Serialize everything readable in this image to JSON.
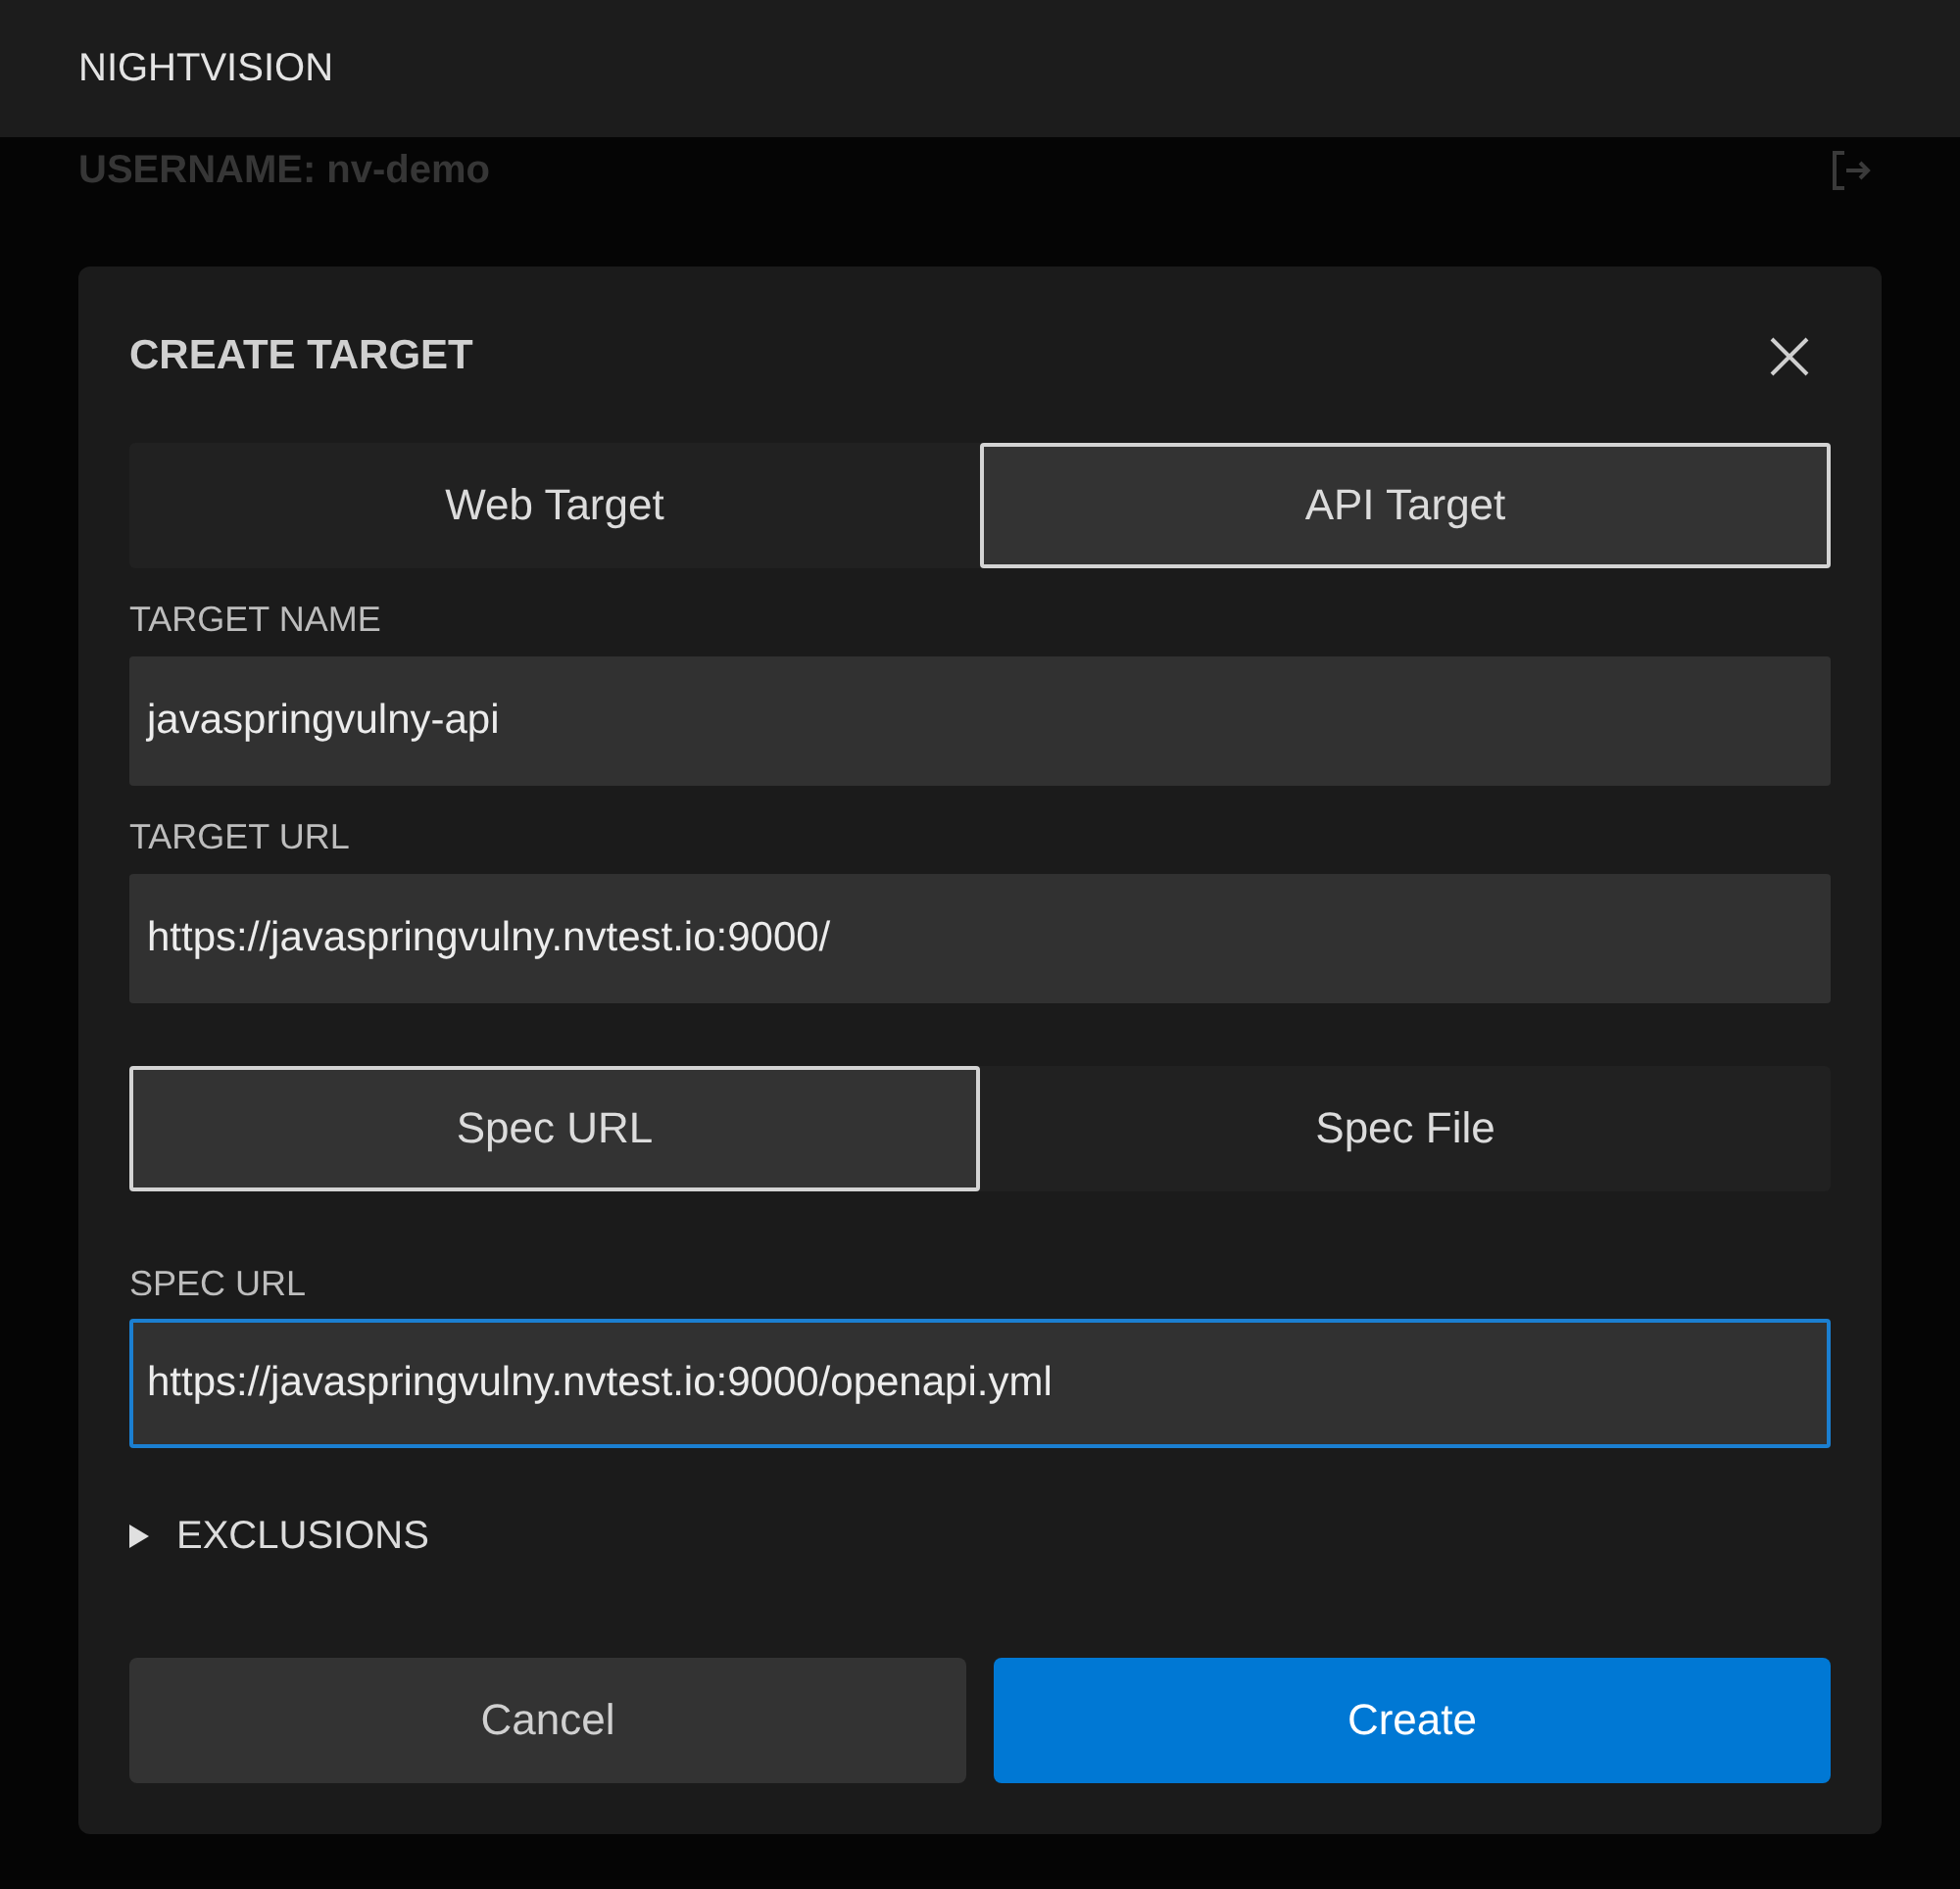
{
  "app_bar": {
    "title": "NIGHTVISION"
  },
  "background": {
    "username": "USERNAME: nv-demo"
  },
  "dialog": {
    "title": "CREATE TARGET",
    "target_types": [
      {
        "label": "Web Target",
        "selected": false
      },
      {
        "label": "API Target",
        "selected": true
      }
    ],
    "fields": [
      {
        "label": "TARGET NAME",
        "value": "javaspringvulny-api",
        "focused": false
      },
      {
        "label": "TARGET URL",
        "value": "https://javaspringvulny.nvtest.io:9000/",
        "focused": false
      }
    ],
    "spec_sources": [
      {
        "label": "Spec URL",
        "selected": true
      },
      {
        "label": "Spec File",
        "selected": false
      }
    ],
    "spec_field": {
      "label": "SPEC URL",
      "value": "https://javaspringvulny.nvtest.io:9000/openapi.yml",
      "focused": true
    },
    "exclusions": {
      "label": "EXCLUSIONS",
      "expanded": false
    },
    "buttons": [
      {
        "label": "Cancel",
        "kind": "secondary"
      },
      {
        "label": "Create",
        "kind": "primary"
      }
    ]
  }
}
